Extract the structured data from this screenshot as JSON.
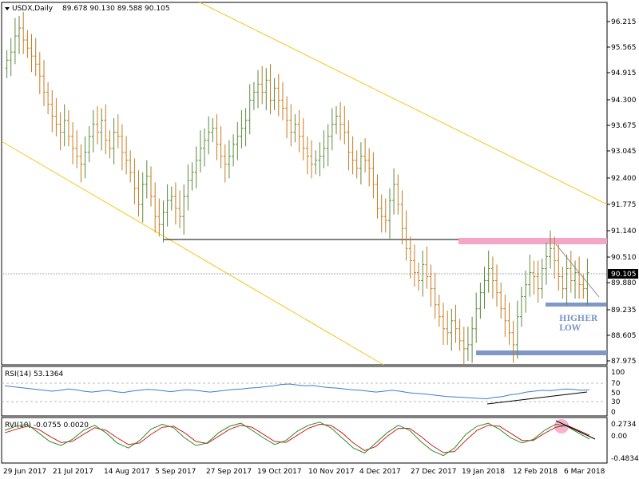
{
  "main": {
    "title": "USDX,Daily",
    "ohlc": "89.678 90.130 89.588 90.105",
    "price_ticks": [
      "96.215",
      "95.565",
      "94.915",
      "94.300",
      "93.675",
      "93.045",
      "92.400",
      "91.775",
      "91.140",
      "90.510",
      "89.880",
      "89.235",
      "88.605",
      "87.975"
    ],
    "current_price": "90.105",
    "annotation_line1": "HIGHER",
    "annotation_line2": "LOW"
  },
  "rsi": {
    "label": "RSI(14) 53.1364",
    "ticks": [
      "100",
      "70",
      "50",
      "30",
      "0"
    ]
  },
  "rvi": {
    "label": "RVI(10) -0.0755 0.0020",
    "ticks": [
      "0.2734",
      "0.00",
      "-0.4834"
    ]
  },
  "x_axis": {
    "labels": [
      "29 Jun 2017",
      "21 Jul 2017",
      "14 Aug 2017",
      "5 Sep 2017",
      "27 Sep 2017",
      "19 Oct 2017",
      "10 Nov 2017",
      "4 Dec 2017",
      "27 Dec 2017",
      "19 Jan 2018",
      "12 Feb 2018",
      "6 Mar 2018"
    ]
  },
  "colors": {
    "bull": "#5b8a3c",
    "bear": "#c97a1e",
    "channel": "#f5c518",
    "rsi_line": "#3a7fc9",
    "rvi_main": "#2e8b2e",
    "rvi_signal": "#d02020",
    "zone": "#f4a6c8",
    "support": "#7f98c8"
  },
  "chart_data": [
    {
      "type": "candlestick",
      "title": "USDX,Daily",
      "ylim": [
        87.9,
        96.5
      ],
      "x_range": [
        "29 Jun 2017",
        "14 Mar 2018"
      ],
      "closes": [
        95.4,
        95.6,
        96.0,
        96.2,
        95.9,
        95.7,
        95.5,
        95.3,
        95.0,
        94.6,
        94.3,
        94.0,
        93.8,
        93.6,
        93.9,
        93.5,
        93.2,
        93.0,
        92.8,
        93.1,
        93.5,
        93.8,
        93.6,
        93.9,
        93.4,
        93.2,
        93.6,
        93.5,
        93.1,
        92.9,
        92.6,
        92.2,
        91.8,
        92.3,
        92.5,
        92.0,
        91.5,
        91.3,
        91.6,
        91.9,
        92.0,
        91.7,
        91.5,
        92.0,
        92.4,
        92.6,
        92.9,
        93.2,
        93.4,
        93.6,
        93.7,
        93.3,
        93.0,
        92.8,
        93.0,
        93.3,
        93.5,
        93.7,
        93.9,
        94.4,
        94.6,
        94.8,
        94.6,
        94.9,
        94.4,
        94.7,
        94.4,
        94.2,
        93.9,
        93.6,
        93.8,
        93.5,
        93.2,
        93.0,
        92.8,
        92.9,
        93.0,
        93.2,
        93.5,
        93.8,
        94.0,
        93.8,
        93.6,
        93.1,
        92.9,
        92.7,
        93.0,
        92.9,
        92.7,
        92.3,
        91.7,
        91.5,
        91.4,
        91.9,
        92.3,
        91.8,
        91.2,
        90.7,
        90.4,
        90.1,
        89.9,
        90.3,
        90.0,
        89.7,
        89.3,
        89.0,
        88.7,
        88.6,
        88.9,
        88.7,
        88.4,
        88.2,
        88.3,
        88.7,
        89.2,
        89.6,
        89.9,
        90.2,
        89.9,
        89.6,
        89.2,
        88.9,
        88.6,
        88.3,
        89.0,
        89.5,
        89.8,
        90.1,
        90.0,
        89.7,
        90.2,
        90.5,
        90.7,
        90.4,
        90.0,
        89.7,
        90.2,
        89.9,
        90.1,
        89.8,
        89.7,
        90.1
      ],
      "channel_upper": {
        "from": [
          "27 Jun 2017",
          96.8
        ],
        "to": [
          "14 Mar 2018",
          91.6
        ]
      },
      "channel_lower": {
        "from": [
          "27 Jun 2017",
          93.1
        ],
        "to": [
          "7 Jan 2018",
          87.9
        ]
      },
      "horizontal_line": 90.98,
      "resistance_zone": [
        90.9,
        91.05
      ],
      "support_lows": [
        88.0,
        89.35
      ],
      "current_price": 90.105,
      "annotation": "HIGHER LOW"
    },
    {
      "type": "line",
      "title": "RSI(14) 53.1364",
      "ylim": [
        0,
        100
      ],
      "levels": [
        30,
        70
      ],
      "series": [
        {
          "values": [
            62,
            60,
            58,
            56,
            54,
            52,
            50,
            52,
            55,
            53,
            50,
            48,
            50,
            52,
            49,
            47,
            50,
            52,
            54,
            53,
            51,
            49,
            51,
            53,
            52,
            50,
            48,
            50,
            52,
            54,
            55,
            57,
            58,
            60,
            62,
            65,
            66,
            64,
            62,
            63,
            60,
            58,
            57,
            55,
            53,
            52,
            50,
            48,
            50,
            52,
            50,
            47,
            45,
            44,
            42,
            40,
            38,
            37,
            36,
            35,
            34,
            33,
            36,
            38,
            42,
            44,
            48,
            50,
            52,
            51,
            53,
            55,
            54,
            52,
            53
          ]
        }
      ],
      "trendline": {
        "from": [
          "19 Jan 2018",
          30
        ],
        "to": [
          "14 Mar 2018",
          45
        ]
      }
    },
    {
      "type": "line",
      "title": "RVI(10) -0.0755 0.0020",
      "ylim": [
        -0.4834,
        0.2734
      ],
      "series": [
        {
          "values": [
            0.1,
            0.18,
            0.22,
            0.05,
            -0.12,
            -0.2,
            -0.08,
            0.1,
            0.2,
            0.05,
            -0.15,
            -0.25,
            -0.1,
            0.12,
            0.22,
            0.15,
            -0.05,
            -0.2,
            -0.15,
            0.05,
            0.18,
            0.24,
            0.1,
            -0.05,
            -0.18,
            -0.1,
            0.08,
            0.2,
            0.26,
            0.15,
            -0.05,
            -0.25,
            -0.35,
            -0.15,
            0.05,
            0.2,
            0.1,
            -0.12,
            -0.3,
            -0.4,
            -0.25,
            0.02,
            0.18,
            0.24,
            0.12,
            -0.05,
            -0.15,
            -0.08,
            0.1,
            0.22,
            0.18,
            0.05,
            -0.0755
          ]
        },
        {
          "values": [
            0.05,
            0.12,
            0.18,
            0.12,
            -0.02,
            -0.14,
            -0.12,
            0.02,
            0.15,
            0.1,
            -0.05,
            -0.18,
            -0.15,
            0.02,
            0.16,
            0.18,
            0.05,
            -0.12,
            -0.16,
            -0.02,
            0.12,
            0.2,
            0.16,
            0.02,
            -0.12,
            -0.14,
            0.0,
            0.14,
            0.22,
            0.2,
            0.05,
            -0.15,
            -0.3,
            -0.22,
            -0.02,
            0.14,
            0.14,
            -0.02,
            -0.2,
            -0.34,
            -0.32,
            -0.1,
            0.1,
            0.2,
            0.18,
            0.04,
            -0.1,
            -0.1,
            0.04,
            0.16,
            0.2,
            0.1,
            0.002
          ]
        }
      ]
    }
  ]
}
